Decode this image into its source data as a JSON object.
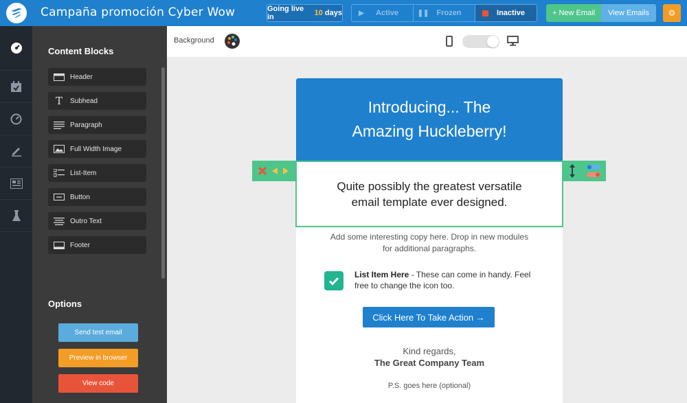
{
  "header": {
    "campaign_title": "Campaña promoción Cyber Wow",
    "live_prefix": "Going live in",
    "live_days": "10",
    "live_suffix": "days",
    "status": [
      {
        "label": "Active"
      },
      {
        "label": "Frozen"
      },
      {
        "label": "Inactive"
      }
    ],
    "new_email": "+ New Email",
    "view_emails": "View Emails"
  },
  "panel": {
    "content_blocks_title": "Content Blocks",
    "blocks": [
      {
        "label": "Header"
      },
      {
        "label": "Subhead"
      },
      {
        "label": "Paragraph"
      },
      {
        "label": "Full Width Image"
      },
      {
        "label": "List-Item"
      },
      {
        "label": "Button"
      },
      {
        "label": "Outro Text"
      },
      {
        "label": "Footer"
      }
    ],
    "options_title": "Options",
    "options": [
      {
        "label": "Send test email",
        "color": "#5aacdc"
      },
      {
        "label": "Preview in browser",
        "color": "#f39c26"
      },
      {
        "label": "View code",
        "color": "#e8543a"
      }
    ]
  },
  "toolbar": {
    "background_label": "Background"
  },
  "email": {
    "hero_line1": "Introducing... The",
    "hero_line2": "Amazing Huckleberry!",
    "subhead_line1": "Quite possibly the greatest versatile",
    "subhead_line2": "email template ever designed.",
    "para_line1": "Add some interesting copy here. Drop in new modules",
    "para_line2": "for additional paragraphs.",
    "list_title": "List Item Here",
    "list_body": " - These can come in handy. Feel free to change the icon too.",
    "cta": "Click Here To Take Action →",
    "regards": "Kind regards,",
    "team": "The Great Company Team",
    "ps": "P.S. goes here (optional)"
  },
  "colors": {
    "brand_blue": "#1f80ce",
    "accent_green": "#4ec58a",
    "orange": "#f39c26",
    "red": "#e8543a"
  }
}
